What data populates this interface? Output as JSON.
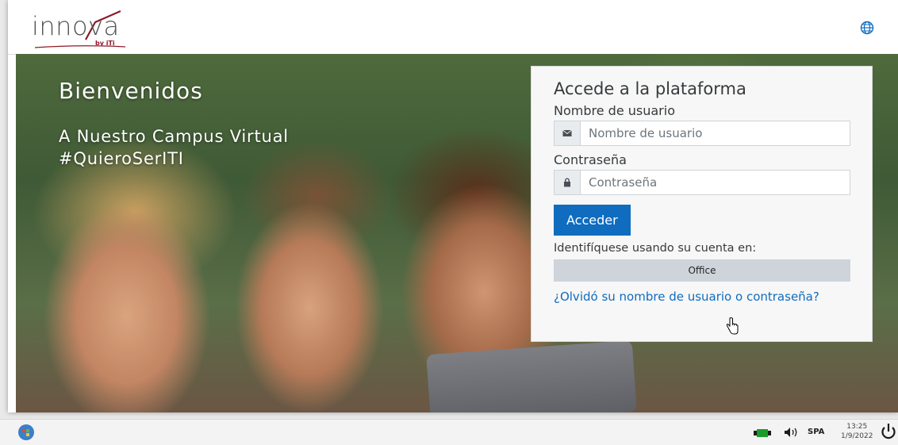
{
  "colors": {
    "accent": "#0f6cbf",
    "brand_red": "#8c1b2a",
    "brand_grey": "#555555",
    "office_button_bg": "#ced4da"
  },
  "header": {
    "logo_text": "innova",
    "logo_byline": "by iTi",
    "language_icon": "globe-icon"
  },
  "hero": {
    "title": "Bienvenidos",
    "subtitle_line1": "A Nuestro Campus Virtual",
    "subtitle_line2": "#QuieroSerITI"
  },
  "login": {
    "heading": "Accede a la plataforma",
    "username_label": "Nombre de usuario",
    "username_placeholder": "Nombre de usuario",
    "username_value": "",
    "username_icon": "envelope-icon",
    "password_label": "Contraseña",
    "password_placeholder": "Contraseña",
    "password_value": "",
    "password_icon": "lock-icon",
    "submit_label": "Acceder",
    "identity_text": "Identifíquese usando su cuenta en:",
    "office_label": "Office",
    "forgot_link": "¿Olvidó su nombre de usuario o contraseña?"
  },
  "taskbar": {
    "start_icon": "start-orb-icon",
    "network_icon": "network-icon",
    "volume_icon": "volume-icon",
    "language": "SPA",
    "time": "13:25",
    "date": "1/9/2022",
    "power_icon": "power-icon"
  }
}
